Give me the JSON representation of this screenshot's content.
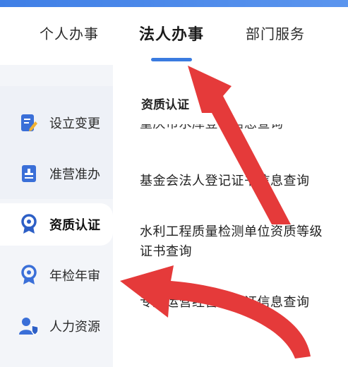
{
  "tabs": [
    {
      "label": "个人办事"
    },
    {
      "label": "法人办事"
    },
    {
      "label": "部门服务"
    }
  ],
  "sidebar": {
    "items": [
      {
        "label": "设立变更",
        "icon": "edit-document-icon"
      },
      {
        "label": "准营准办",
        "icon": "stamp-document-icon"
      },
      {
        "label": "资质认证",
        "icon": "award-ribbon-icon"
      },
      {
        "label": "年检年审",
        "icon": "award-ribbon-icon"
      },
      {
        "label": "人力资源",
        "icon": "user-shield-icon"
      }
    ]
  },
  "content": {
    "section_title": "资质认证",
    "items": [
      {
        "label": "重庆市水库登记信息查询"
      },
      {
        "label": "基金会法人登记证书信息查询"
      },
      {
        "label": "水利工程质量检测单位资质等级证书查询"
      },
      {
        "label": "专属运营经营许可证信息查询"
      }
    ]
  },
  "colors": {
    "accent": "#3a7be0",
    "annotation_arrow": "#e53a3a",
    "sidebar_bg": "#f3f5f9"
  }
}
